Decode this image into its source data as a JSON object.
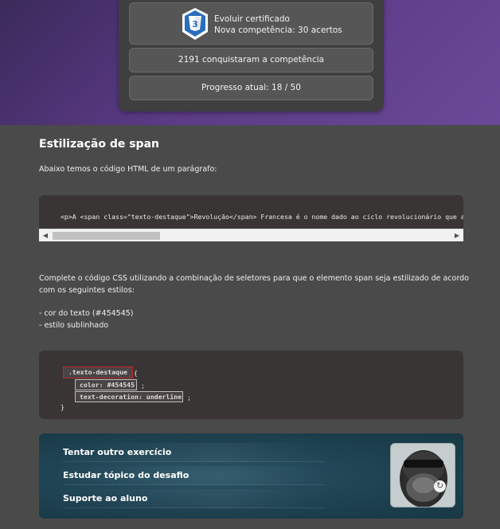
{
  "hero": {
    "cert_line1": "Evoluir certificado",
    "cert_line2": "Nova competência: 30 acertos",
    "badge_icon": "css3-badge-icon",
    "badge_label": "3",
    "conquered": "2191 conquistaram a competência",
    "progress": "Progresso atual: 18 / 50"
  },
  "exercise": {
    "title": "Estilização de span",
    "intro": "Abaixo temos o código HTML de um parágrafo:",
    "html_code": "<p>A <span class=\"texto-destaque\">Revolução</span> Francesa é o nome dado ao ciclo revolucionário que aconteceu na França",
    "instruction_line1": "Complete o código CSS utilizando a combinação de seletores para que o elemento span seja estilizado de acordo",
    "instruction_line2": "com os seguintes estilos:",
    "style_1": "- cor do texto (#454545)",
    "style_2": "- estilo sublinhado"
  },
  "css_code": {
    "selector": ".texto-destaque",
    "brace_open": "{",
    "prop_color": "color: #454545",
    "prop_decoration": "text-decoration: underline",
    "semicolon": ";",
    "brace_close": "}"
  },
  "actions": {
    "items": [
      {
        "label": "Tentar outro exercício"
      },
      {
        "label": "Estudar tópico do desafio"
      },
      {
        "label": "Suporte ao aluno"
      }
    ]
  },
  "scrollbar": {
    "left_arrow": "◀",
    "right_arrow": "▶"
  },
  "video": {
    "refresh_glyph": "↻"
  },
  "colors": {
    "hero_purple": "#5b3a86",
    "page_bg": "#4a4a4a",
    "code_bg": "#3a3535",
    "selector_border": "#c0282b",
    "css3_blue": "#2a6ebb"
  }
}
